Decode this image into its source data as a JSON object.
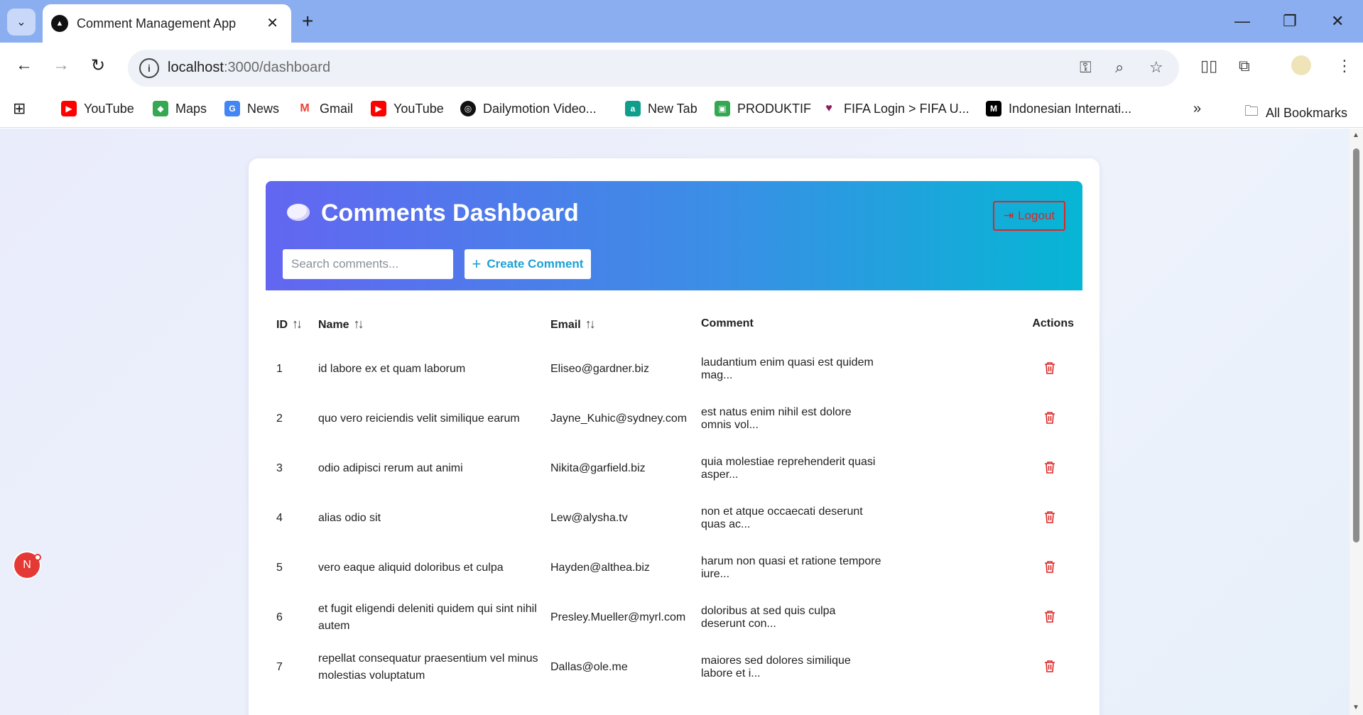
{
  "browser": {
    "tab_title": "Comment Management App",
    "url_host": "localhost",
    "url_path": ":3000/dashboard",
    "bookmarks": [
      {
        "label": "YouTube",
        "icon": "youtube-icon",
        "color": "#ff0000"
      },
      {
        "label": "Maps",
        "icon": "maps-icon",
        "color": "#34a853"
      },
      {
        "label": "News",
        "icon": "news-icon",
        "color": "#4285f4"
      },
      {
        "label": "Gmail",
        "icon": "gmail-icon",
        "color": "#ea4335"
      },
      {
        "label": "YouTube",
        "icon": "youtube-icon",
        "color": "#ff0000"
      },
      {
        "label": "Dailymotion Video...",
        "icon": "dailymotion-icon",
        "color": "#111111"
      },
      {
        "label": "New Tab",
        "icon": "newtab-icon",
        "color": "#0f9d8c"
      },
      {
        "label": "PRODUKTIF",
        "icon": "produktif-icon",
        "color": "#34a853"
      },
      {
        "label": "FIFA Login > FIFA U...",
        "icon": "fifa-icon",
        "color": "#8b1a5a"
      },
      {
        "label": "Indonesian Internati...",
        "icon": "m-icon",
        "color": "#000000"
      }
    ],
    "all_bookmarks": "All Bookmarks"
  },
  "app": {
    "title": "Comments Dashboard",
    "logout_label": "Logout",
    "search_placeholder": "Search comments...",
    "create_label": "Create Comment",
    "columns": {
      "id": "ID",
      "name": "Name",
      "email": "Email",
      "comment": "Comment",
      "actions": "Actions"
    },
    "rows": [
      {
        "id": "1",
        "name": "id labore ex et quam laborum",
        "email": "Eliseo@gardner.biz",
        "comment": "laudantium enim quasi est quidem mag..."
      },
      {
        "id": "2",
        "name": "quo vero reiciendis velit similique earum",
        "email": "Jayne_Kuhic@sydney.com",
        "comment": "est natus enim nihil est dolore omnis vol..."
      },
      {
        "id": "3",
        "name": "odio adipisci rerum aut animi",
        "email": "Nikita@garfield.biz",
        "comment": "quia molestiae reprehenderit quasi asper..."
      },
      {
        "id": "4",
        "name": "alias odio sit",
        "email": "Lew@alysha.tv",
        "comment": "non et atque occaecati deserunt quas ac..."
      },
      {
        "id": "5",
        "name": "vero eaque aliquid doloribus et culpa",
        "email": "Hayden@althea.biz",
        "comment": "harum non quasi et ratione tempore iure..."
      },
      {
        "id": "6",
        "name": "et fugit eligendi deleniti quidem qui sint nihil autem",
        "email": "Presley.Mueller@myrl.com",
        "comment": "doloribus at sed quis culpa deserunt con..."
      },
      {
        "id": "7",
        "name": "repellat consequatur praesentium vel minus molestias voluptatum",
        "email": "Dallas@ole.me",
        "comment": "maiores sed dolores similique labore et i..."
      }
    ]
  },
  "dev_badge": "N",
  "colors": {
    "danger": "#dc2626",
    "accent": "#1aa0d6",
    "gradient_start": "#6366f1",
    "gradient_end": "#06b6d4"
  }
}
